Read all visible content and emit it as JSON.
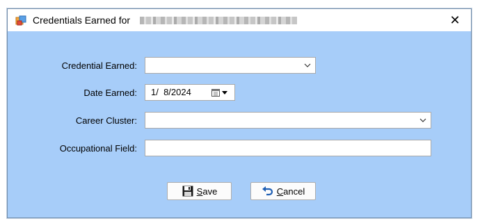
{
  "window": {
    "title": "Credentials Earned for",
    "close_glyph": "✕"
  },
  "form": {
    "credential_label": "Credential Earned:",
    "credential_value": "",
    "date_label": "Date Earned:",
    "date_value": "1/  8/2024",
    "cluster_label": "Career Cluster:",
    "cluster_value": "",
    "occupational_label": "Occupational Field:",
    "occupational_value": ""
  },
  "buttons": {
    "save_access": "S",
    "save_rest": "ave",
    "cancel_access": "C",
    "cancel_rest": "ancel"
  },
  "icons": {
    "app": "form-icon",
    "dropdown": "chevron-down-icon",
    "calendar": "calendar-icon",
    "save": "floppy-disk-icon",
    "cancel": "undo-arrow-icon"
  },
  "colors": {
    "client_background": "#a7cdf9",
    "title_background": "#ffffff"
  }
}
